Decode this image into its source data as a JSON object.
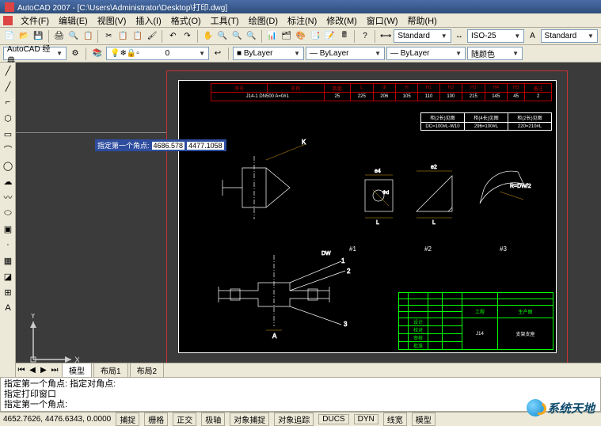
{
  "title": "AutoCAD 2007 - [C:\\Users\\Administrator\\Desktop\\打印.dwg]",
  "menu": [
    "文件(F)",
    "编辑(E)",
    "视图(V)",
    "插入(I)",
    "格式(O)",
    "工具(T)",
    "绘图(D)",
    "标注(N)",
    "修改(M)",
    "窗口(W)",
    "帮助(H)"
  ],
  "workspace": "AutoCAD 经典",
  "style_combo": "Standard",
  "dim_combo": "ISO-25",
  "text_combo": "Standard",
  "layer_combo": "0",
  "color_combo": "■ ByLayer",
  "ltype_combo": "— ByLayer",
  "lweight_combo": "— ByLayer",
  "plotcolor_combo": "随颜色",
  "parts_header": [
    "序号",
    "名称",
    "数量",
    "L",
    "Φ",
    "H",
    "H1",
    "H2",
    "H3",
    "H4",
    "H5",
    "备注"
  ],
  "parts_row": "J14-1 DN500 A=0#1",
  "spec": {
    "h1": "柜(2长)见图",
    "h2": "柜(4长)见图",
    "h3": "柜(2长)见图",
    "v1": "DC=100#L-W10",
    "v2": "296=100#L",
    "v3": "220=210#L"
  },
  "tooltip": {
    "label": "指定第一个角点:",
    "x": "4686.578",
    "y": "4477.1058"
  },
  "dwg_labels": {
    "k": "K",
    "dw": "DW",
    "e4": "e4",
    "e2": "e2",
    "L": "L",
    "phid": "Φd",
    "rdw2": "R=DW/2",
    "n1": "1",
    "n2": "2",
    "n3": "3",
    "a": "A",
    "m1": "#1",
    "m2": "#2",
    "m3": "#3"
  },
  "titleblock": {
    "proj": "工程",
    "prod": "生产图",
    "code": "J14",
    "name": "支架支座"
  },
  "ucs": {
    "x": "X",
    "y": "Y"
  },
  "tabs": {
    "model": "模型",
    "layout1": "布局1",
    "layout2": "布局2"
  },
  "cmd": {
    "l1": "指定第一个角点: 指定对角点:",
    "l2": "指定打印窗口",
    "l3": "指定第一个角点:"
  },
  "status": {
    "coords": "4652.7626, 4476.6343, 0.0000",
    "btns": [
      "捕捉",
      "栅格",
      "正交",
      "极轴",
      "对象捕捉",
      "对象追踪",
      "DUCS",
      "DYN",
      "线宽",
      "模型"
    ]
  },
  "watermark": "系统天地"
}
